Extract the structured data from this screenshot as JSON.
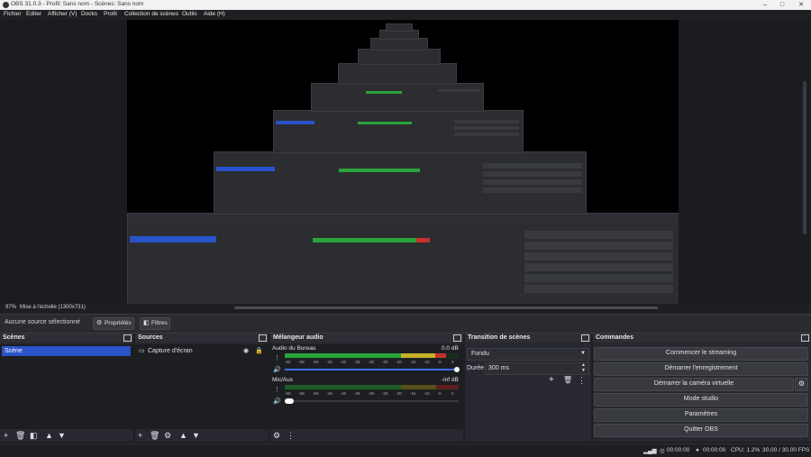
{
  "window": {
    "title": "OBS 31.0.3 - Profil: Sans nom - Scènes: Sans nom",
    "minimize": "–",
    "maximize": "□",
    "close": "✕"
  },
  "menu": [
    "Fichier",
    "Editer",
    "Afficher (V)",
    "Docks",
    "Profil",
    "Collection de scènes",
    "Outils",
    "Aide (H)"
  ],
  "preview": {
    "zoom": "97%",
    "scale_label": "Mise à l'échelle (1300x731)"
  },
  "source_bar": {
    "no_source": "Aucune source sélectionné",
    "properties": "Propriétés",
    "filters": "Filtres"
  },
  "scenes": {
    "title": "Scènes",
    "items": [
      "Scène"
    ]
  },
  "sources": {
    "title": "Sources",
    "items": [
      "Capture d'écran"
    ]
  },
  "mixer": {
    "title": "Mélangeur audio",
    "channels": [
      {
        "name": "Audio du Bureau",
        "db": "0.0 dB",
        "level": 0.93
      },
      {
        "name": "Mic/Aux",
        "db": "-inf dB",
        "level": 0.0
      }
    ],
    "ticks": [
      "-60",
      "-55",
      "-50",
      "-45",
      "-40",
      "-35",
      "-30",
      "-25",
      "-20",
      "-15",
      "-10",
      "-5",
      "0"
    ]
  },
  "transitions": {
    "title": "Transition de scènes",
    "selected": "Fondu",
    "duration_label": "Durée",
    "duration_value": "300 ms"
  },
  "controls": {
    "title": "Commandes",
    "buttons": [
      "Commencer le streaming",
      "Démarrer l'enregistrement",
      "Démarrer la caméra virtuelle",
      "Mode studio",
      "Paramètres",
      "Quitter OBS"
    ]
  },
  "status": {
    "stream_time": "00:00:00",
    "rec_time": "00:00:00",
    "cpu": "CPU: 1.2%",
    "fps": "30.00 / 30.00 FPS"
  },
  "colors": {
    "scene_selected": "#2a53c9",
    "meter_green": "#2aa43b",
    "meter_yellow": "#c8b02a",
    "meter_red": "#c8312e",
    "volume_blue": "#3c6ee8"
  }
}
